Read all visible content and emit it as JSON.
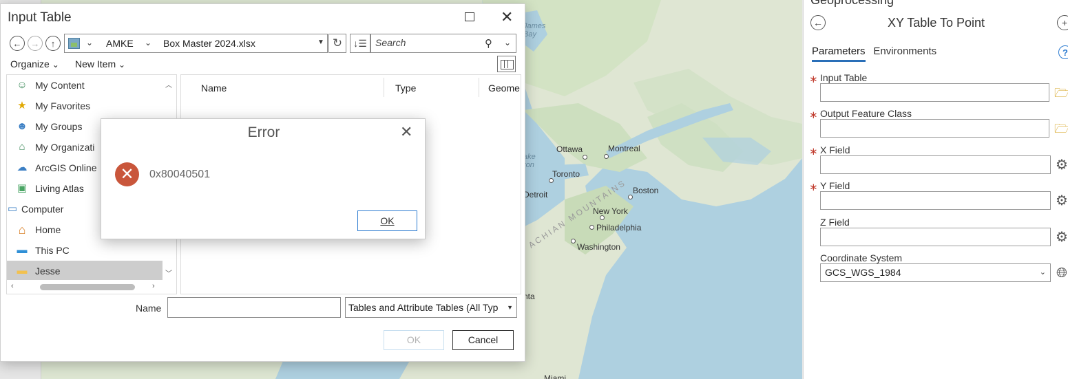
{
  "map": {
    "labels": {
      "james_bay": "James\nBay",
      "ottawa": "Ottawa",
      "montreal": "Montreal",
      "toronto": "Toronto",
      "detroit": "Detroit",
      "boston": "Boston",
      "new_york": "New York",
      "philadelphia": "Philadelphia",
      "washington": "Washington",
      "appalachian": "ACHIAN MOUNTAINS",
      "lake": "ake\nron",
      "atlanta": "nta",
      "miami": "Miami"
    }
  },
  "geoprocessing": {
    "pane_title": "Geoprocessing",
    "tool_name": "XY Table To Point",
    "back_icon": "arrow-left-icon",
    "add_icon": "plus-circle-icon",
    "help_icon": "help-icon",
    "tabs": [
      {
        "label": "Parameters",
        "active": true
      },
      {
        "label": "Environments",
        "active": false
      }
    ],
    "parameters": [
      {
        "label": "Input Table",
        "required": true,
        "value": "",
        "button_icon": "folder-open-icon"
      },
      {
        "label": "Output Feature Class",
        "required": true,
        "value": "",
        "button_icon": "folder-open-icon"
      },
      {
        "label": "X Field",
        "required": true,
        "value": "",
        "button_icon": "gear-icon"
      },
      {
        "label": "Y Field",
        "required": true,
        "value": "",
        "button_icon": "gear-icon"
      },
      {
        "label": "Z Field",
        "required": false,
        "value": "",
        "button_icon": "gear-icon"
      },
      {
        "label": "Coordinate System",
        "required": false,
        "value": "GCS_WGS_1984",
        "button_icon": "globe-icon"
      }
    ],
    "required_marker": "∗"
  },
  "input_dialog": {
    "title": "Input Table",
    "path": {
      "segment1": "AMKE",
      "segment2": "Box Master 2024.xlsx"
    },
    "search": {
      "placeholder": "Search",
      "value": ""
    },
    "toolbar": {
      "organize": "Organize",
      "new_item": "New Item"
    },
    "nav_items": [
      {
        "label": "My Content",
        "icon": "my-content-icon",
        "glyph": "☺",
        "color": "#3d8a5a"
      },
      {
        "label": "My Favorites",
        "icon": "favorites-icon",
        "glyph": "★",
        "color": "#e0a800"
      },
      {
        "label": "My Groups",
        "icon": "groups-icon",
        "glyph": "☻",
        "color": "#3b7fc4"
      },
      {
        "label": "My Organizati",
        "icon": "organization-icon",
        "glyph": "⌂",
        "color": "#3d8a5a"
      },
      {
        "label": "ArcGIS Online",
        "icon": "cloud-icon",
        "glyph": "☁",
        "color": "#3b7fc4"
      },
      {
        "label": "Living Atlas",
        "icon": "living-atlas-icon",
        "glyph": "▣",
        "color": "#4aa564"
      },
      {
        "label": "Computer",
        "icon": "computer-icon",
        "glyph": "▭",
        "color": "#3b7fc4"
      },
      {
        "label": "Home",
        "icon": "home-icon",
        "glyph": "⌂",
        "color": "#d9822b"
      },
      {
        "label": "This PC",
        "icon": "pc-icon",
        "glyph": "▬",
        "color": "#2f8fd6"
      },
      {
        "label": "Jesse",
        "icon": "folder-icon",
        "glyph": "▬",
        "color": "#f2c14e"
      }
    ],
    "columns": [
      "Name",
      "Type",
      "Geome"
    ],
    "name_label": "Name",
    "name_value": "",
    "type_filter": "Tables and Attribute Tables (All Typ",
    "ok_label": "OK",
    "cancel_label": "Cancel"
  },
  "error_dialog": {
    "title": "Error",
    "message": "0x80040501",
    "ok_label": "OK",
    "icon": "error-x-icon"
  },
  "colors": {
    "accent": "#2a6fb8",
    "error": "#c9563b",
    "required": "#c0392b",
    "water": "#aed0e0",
    "land": "#dfe7d4"
  }
}
